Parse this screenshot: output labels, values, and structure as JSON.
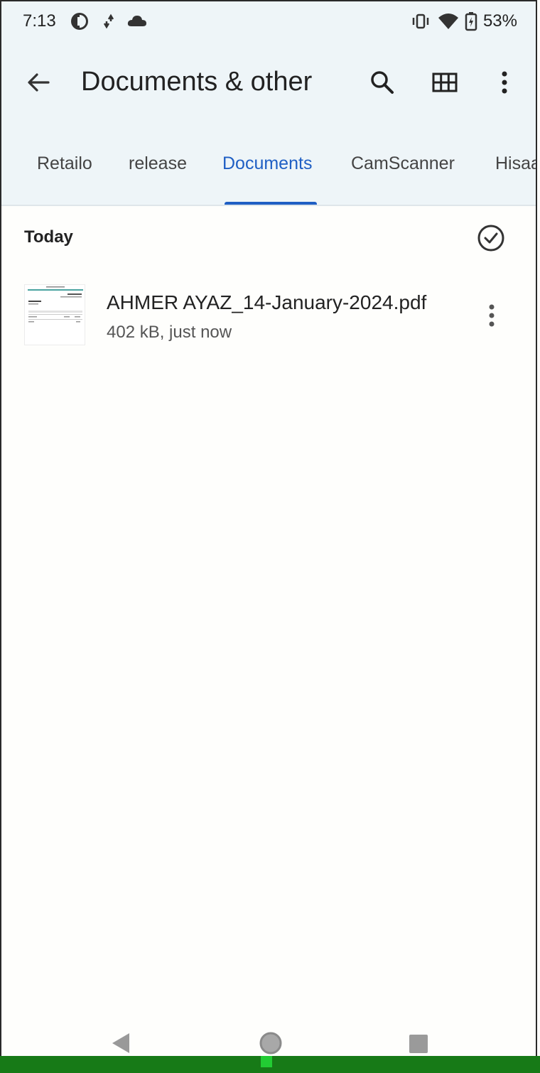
{
  "status_bar": {
    "time": "7:13",
    "battery_percent": "53%",
    "icons": [
      "data-saver-icon",
      "sync-arrows-icon",
      "cloud-icon",
      "vibrate-icon",
      "wifi-icon",
      "battery-charging-icon"
    ]
  },
  "app_bar": {
    "title": "Documents & other",
    "back_icon": "arrow-back-icon",
    "actions": [
      "search-icon",
      "grid-view-icon",
      "more-vert-icon"
    ]
  },
  "tabs": [
    {
      "label": "Retailo",
      "active": false
    },
    {
      "label": "release",
      "active": false
    },
    {
      "label": "Documents",
      "active": true
    },
    {
      "label": "CamScanner",
      "active": false
    },
    {
      "label": "Hisaab",
      "active": false
    }
  ],
  "section": {
    "title": "Today",
    "select_icon": "check-circle-icon"
  },
  "files": [
    {
      "name": "AHMER AYAZ_14-January-2024.pdf",
      "meta": "402 kB, just now",
      "icon": "pdf-thumbnail"
    }
  ],
  "nav_bar": {
    "icons": [
      "back-triangle-icon",
      "home-circle-icon",
      "recents-square-icon"
    ]
  },
  "colors": {
    "accent": "#1f5fc4",
    "header_bg": "#eef5f8",
    "bottom_strip": "#177a17"
  }
}
